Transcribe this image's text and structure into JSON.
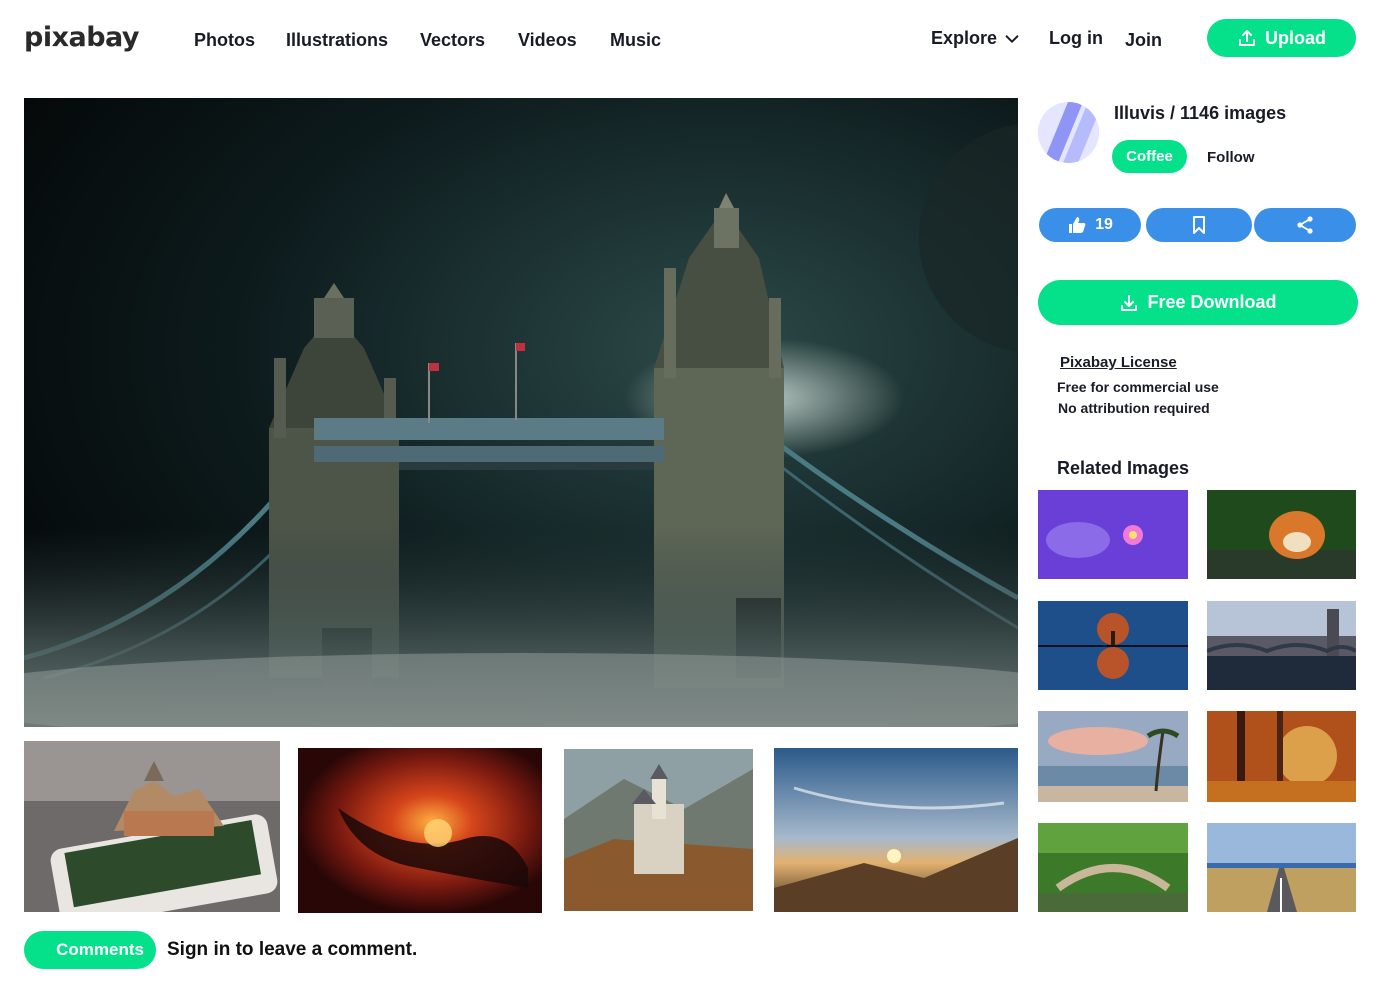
{
  "header": {
    "logo": "pixabay",
    "nav": [
      "Photos",
      "Illustrations",
      "Vectors",
      "Videos",
      "Music"
    ],
    "explore": "Explore",
    "login": "Log in",
    "join": "Join",
    "upload": "Upload"
  },
  "author": {
    "name_line": "Illuvis / 1146 images",
    "coffee": "Coffee",
    "follow": "Follow"
  },
  "actions": {
    "likes": "19"
  },
  "download": {
    "label": "Free Download"
  },
  "license": {
    "link": "Pixabay License",
    "line1": "Free for commercial use",
    "line2": "No attribution required"
  },
  "related": {
    "title": "Related Images"
  },
  "comments": {
    "button": "Comments",
    "prompt": "Sign in to leave a comment."
  },
  "colors": {
    "accent_green": "#05e08a",
    "action_blue": "#3a8fe8",
    "text_dark": "#191b26"
  },
  "icons": {
    "explore": "chevron-down-icon",
    "upload": "upload-icon",
    "like": "thumbs-up-icon",
    "save": "bookmark-icon",
    "share": "share-icon",
    "download": "download-icon"
  }
}
